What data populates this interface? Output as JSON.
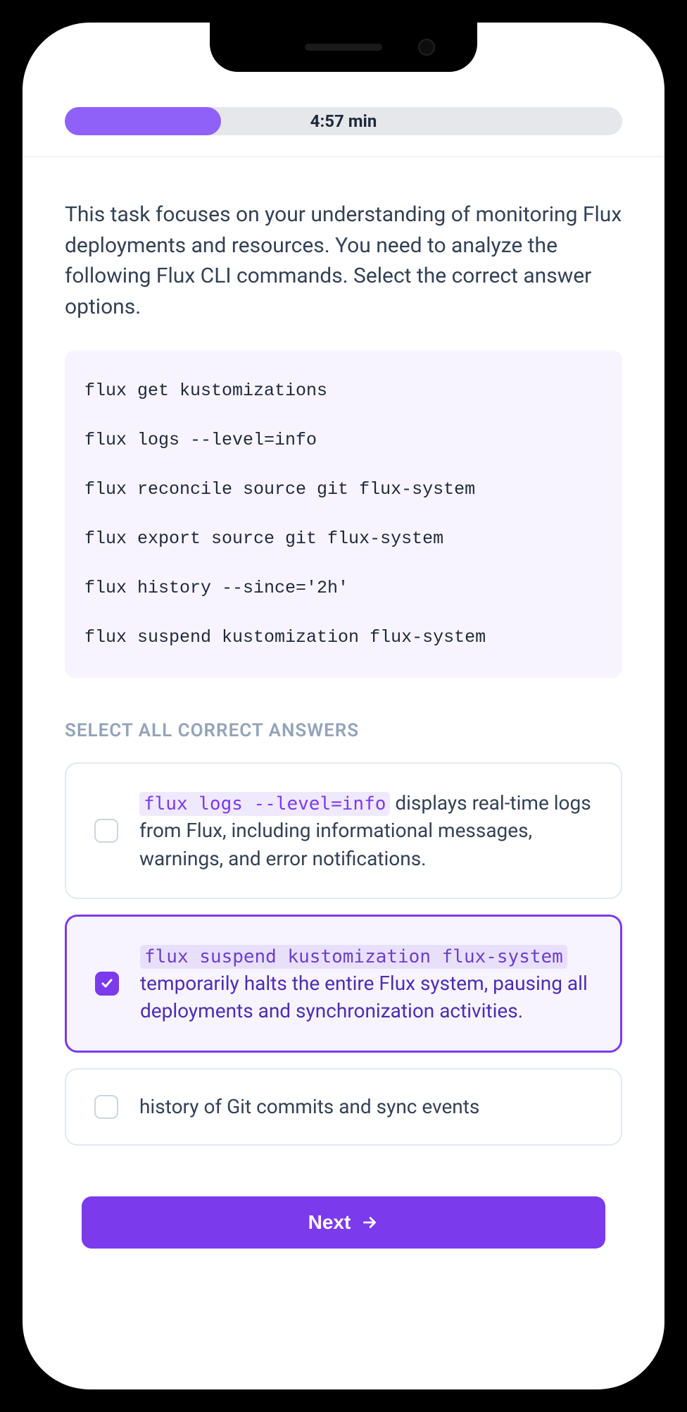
{
  "progress": {
    "time_label": "4:57 min",
    "percent": 28
  },
  "question": {
    "prompt": "This task focuses on your understanding of monitoring Flux deployments and resources. You need to analyze the following Flux CLI commands. Select the correct answer options.",
    "code": "flux get kustomizations\n\nflux logs --level=info\n\nflux reconcile source git flux-system\n\nflux export source git flux-system\n\nflux history --since='2h'\n\nflux suspend kustomization flux-system"
  },
  "answers": {
    "label": "SELECT ALL CORRECT ANSWERS",
    "options": [
      {
        "code": "flux logs --level=info",
        "text": " displays real-time logs from Flux, including informational messages, warnings, and error notifications.",
        "selected": false
      },
      {
        "code": "flux suspend kustomization flux-system",
        "text": " temporarily halts the entire Flux system, pausing all deployments and synchronization activities.",
        "selected": true
      }
    ],
    "cutoff_text": "history of Git commits and sync events"
  },
  "next_label": "Next"
}
